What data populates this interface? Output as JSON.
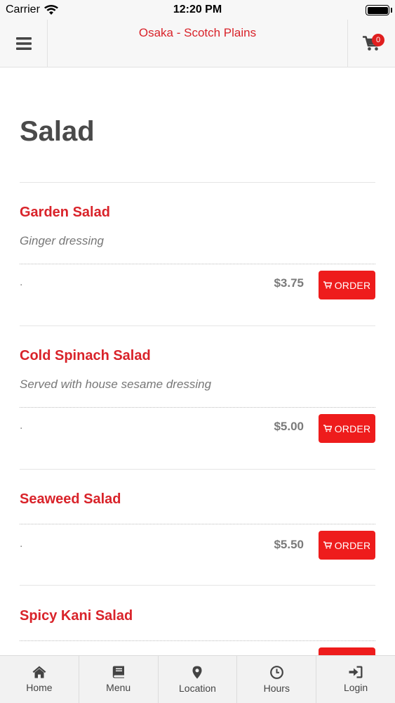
{
  "status_bar": {
    "carrier": "Carrier",
    "time": "12:20 PM"
  },
  "header": {
    "title": "Osaka - Scotch Plains",
    "cart_count": "0"
  },
  "section": {
    "title": "Salad"
  },
  "items": [
    {
      "name": "Garden Salad",
      "description": "Ginger dressing",
      "dot": ".",
      "price": "$3.75",
      "order_label": "ORDER"
    },
    {
      "name": "Cold Spinach Salad",
      "description": "Served with house sesame dressing",
      "dot": ".",
      "price": "$5.00",
      "order_label": "ORDER"
    },
    {
      "name": "Seaweed Salad",
      "description": "",
      "dot": ".",
      "price": "$5.50",
      "order_label": "ORDER"
    },
    {
      "name": "Spicy Kani Salad",
      "description": "",
      "dot": "",
      "price": "",
      "order_label": ""
    }
  ],
  "tabs": [
    {
      "label": "Home",
      "icon": "home-icon"
    },
    {
      "label": "Menu",
      "icon": "book-icon"
    },
    {
      "label": "Location",
      "icon": "map-pin-icon"
    },
    {
      "label": "Hours",
      "icon": "clock-icon"
    },
    {
      "label": "Login",
      "icon": "login-icon"
    }
  ],
  "colors": {
    "accent": "#d9232a",
    "button": "#ee1c1c"
  }
}
